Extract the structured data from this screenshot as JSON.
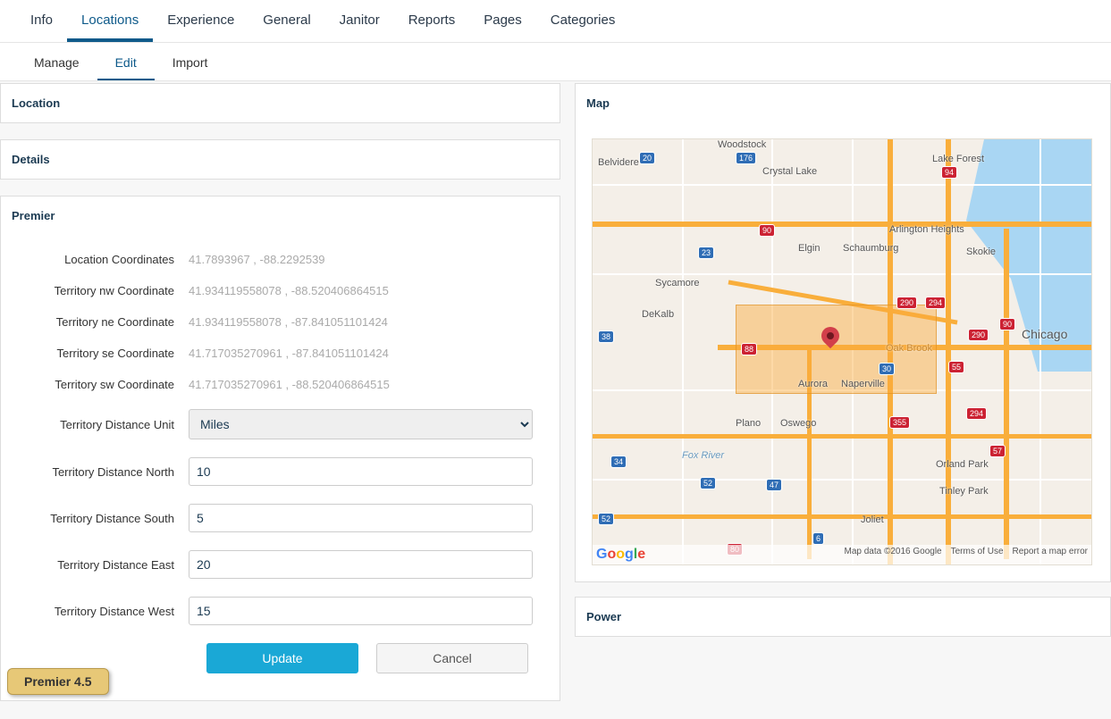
{
  "topnav": {
    "items": [
      "Info",
      "Locations",
      "Experience",
      "General",
      "Janitor",
      "Reports",
      "Pages",
      "Categories"
    ],
    "active": 1
  },
  "subtabs": {
    "items": [
      "Manage",
      "Edit",
      "Import"
    ],
    "active": 1
  },
  "panels": {
    "location": "Location",
    "details": "Details",
    "premier": "Premier",
    "map": "Map",
    "power": "Power"
  },
  "form": {
    "labels": {
      "loc_coords": "Location Coordinates",
      "nw": "Territory nw Coordinate",
      "ne": "Territory ne Coordinate",
      "se": "Territory se Coordinate",
      "sw": "Territory sw Coordinate",
      "unit": "Territory Distance Unit",
      "north": "Territory Distance North",
      "south": "Territory Distance South",
      "east": "Territory Distance East",
      "west": "Territory Distance West"
    },
    "values": {
      "loc_coords": "41.7893967 , -88.2292539",
      "nw": "41.934119558078 , -88.520406864515",
      "ne": "41.934119558078 , -87.841051101424",
      "se": "41.717035270961 , -87.841051101424",
      "sw": "41.717035270961 , -88.520406864515",
      "unit": "Miles",
      "north": "10",
      "south": "5",
      "east": "20",
      "west": "15"
    },
    "buttons": {
      "update": "Update",
      "cancel": "Cancel"
    }
  },
  "map": {
    "cities": {
      "woodstock": "Woodstock",
      "belvidere": "Belvidere",
      "lake_forest": "Lake Forest",
      "crystal_lake": "Crystal Lake",
      "elgin": "Elgin",
      "schaumburg": "Schaumburg",
      "arlington": "Arlington Heights",
      "skokie": "Skokie",
      "sycamore": "Sycamore",
      "dekalb": "DeKalb",
      "chicago": "Chicago",
      "oak_brook": "Oak Brook",
      "aurora": "Aurora",
      "naperville": "Naperville",
      "plano": "Plano",
      "oswego": "Oswego",
      "orland_park": "Orland Park",
      "tinley_park": "Tinley Park",
      "fox_river": "Fox River",
      "joliet": "Joliet"
    },
    "shields": {
      "s20": "20",
      "s176": "176",
      "s94": "94",
      "s90": "90",
      "s23": "23",
      "s290": "290",
      "s294": "294",
      "s290b": "290",
      "s88": "88",
      "s38": "38",
      "s30": "30",
      "s55": "55",
      "s34": "34",
      "s47": "47",
      "s355": "355",
      "s57": "57",
      "s6": "6",
      "s52": "52",
      "s52b": "52",
      "s80": "80",
      "s90b": "90",
      "s294b": "294"
    },
    "footer": {
      "mapdata": "Map data ©2016 Google",
      "terms": "Terms of Use",
      "report": "Report a map error"
    }
  },
  "badge": "Premier 4.5"
}
